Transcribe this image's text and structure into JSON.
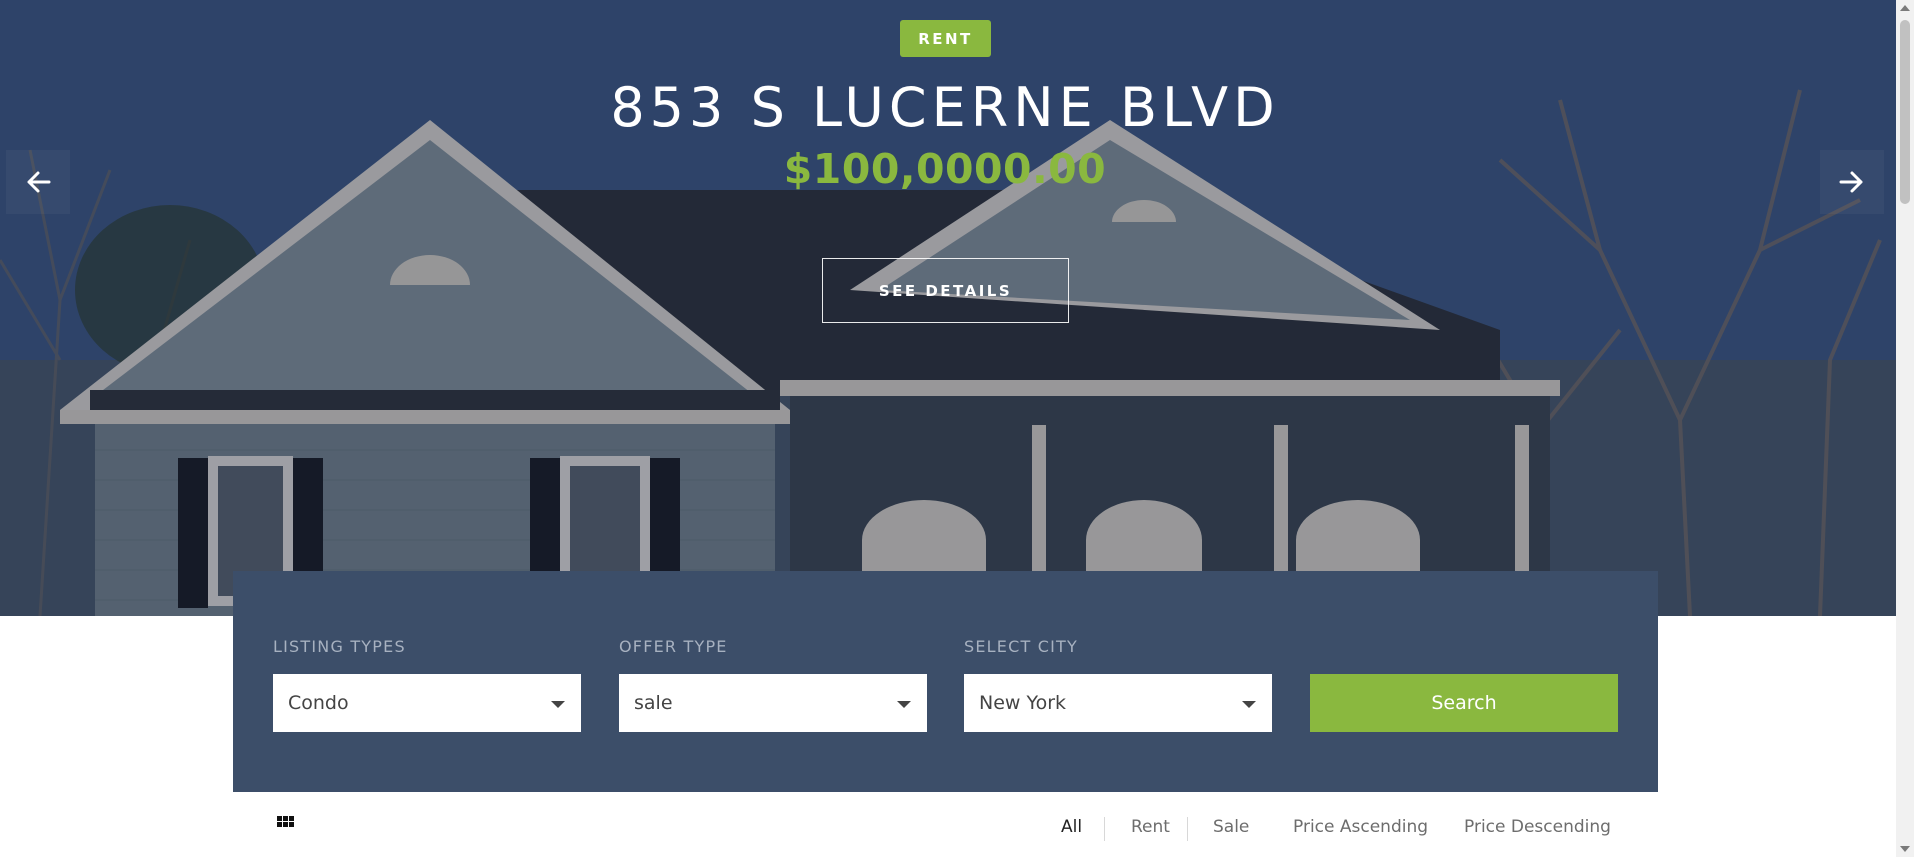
{
  "hero": {
    "badge": "RENT",
    "title": "853 S LUCERNE BLVD",
    "price": "$100,0000.00",
    "details_label": "SEE DETAILS",
    "prev_icon": "arrow-left-icon",
    "next_icon": "arrow-right-icon"
  },
  "search": {
    "fields": [
      {
        "label": "LISTING TYPES",
        "value": "Condo"
      },
      {
        "label": "OFFER TYPE",
        "value": "sale"
      },
      {
        "label": "SELECT CITY",
        "value": "New York"
      }
    ],
    "button_label": "Search"
  },
  "filters": {
    "view_icon": "grid-view-icon",
    "items": [
      "All",
      "Rent",
      "Sale",
      "Price Ascending",
      "Price Descending"
    ],
    "active": "All"
  },
  "colors": {
    "accent": "#8ab83f",
    "panel": "#3c4e69"
  }
}
